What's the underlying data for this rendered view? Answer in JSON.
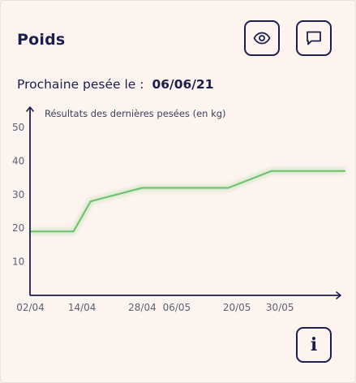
{
  "card": {
    "title": "Poids",
    "view_icon": "eye-icon",
    "comment_icon": "comment-icon",
    "info_icon": "info-icon",
    "info_label": "i",
    "next_weigh_label": "Prochaine pesée le :",
    "next_weigh_date": "06/06/21"
  },
  "colors": {
    "ink": "#1a1f4f",
    "line": "#6cbf6b",
    "card_bg": "#fdf4ef"
  },
  "chart_data": {
    "type": "line",
    "title": "Résultats des dernières pesées (en kg)",
    "x": [
      "02/04",
      "12/04",
      "16/04",
      "28/04",
      "04/05",
      "18/05",
      "28/05",
      "12/06"
    ],
    "x_tick_labels": [
      "02/04",
      "14/04",
      "28/04",
      "06/05",
      "20/05",
      "30/05"
    ],
    "series": [
      {
        "values": [
          19,
          19,
          28,
          32,
          32,
          32,
          37,
          37
        ]
      }
    ],
    "y_ticks": [
      10,
      20,
      30,
      40,
      50
    ],
    "ylim": [
      0,
      55
    ],
    "grid": false
  }
}
